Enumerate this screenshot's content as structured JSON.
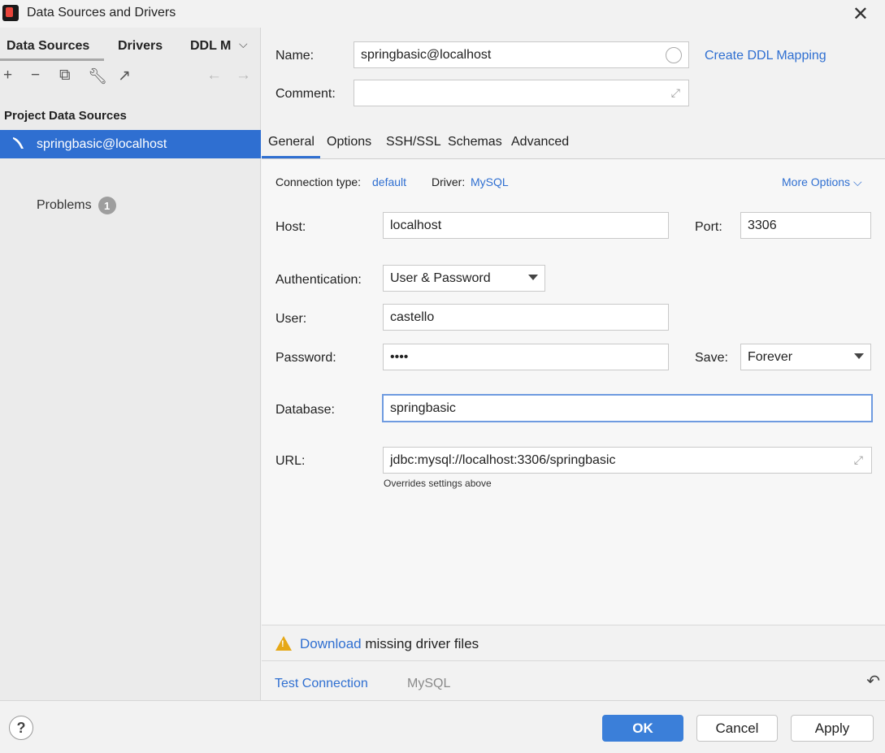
{
  "window": {
    "title": "Data Sources and Drivers"
  },
  "left": {
    "tabs": [
      "Data Sources",
      "Drivers",
      "DDL M"
    ],
    "section_title": "Project Data Sources",
    "selected_item": "springbasic@localhost",
    "problems_label": "Problems",
    "problems_count": "1"
  },
  "form": {
    "name_label": "Name:",
    "name_value": "springbasic@localhost",
    "create_ddl_link": "Create DDL Mapping",
    "comment_label": "Comment:",
    "comment_value": ""
  },
  "tabs": [
    "General",
    "Options",
    "SSH/SSL",
    "Schemas",
    "Advanced"
  ],
  "general": {
    "connection_type_label": "Connection type:",
    "connection_type_value": "default",
    "driver_label": "Driver:",
    "driver_value": "MySQL",
    "more_options": "More Options",
    "host_label": "Host:",
    "host_value": "localhost",
    "port_label": "Port:",
    "port_value": "3306",
    "auth_label": "Authentication:",
    "auth_value": "User & Password",
    "user_label": "User:",
    "user_value": "castello",
    "password_label": "Password:",
    "password_value": "••••",
    "save_label": "Save:",
    "save_value": "Forever",
    "database_label": "Database:",
    "database_value": "springbasic",
    "url_label": "URL:",
    "url_value": "jdbc:mysql://localhost:3306/springbasic",
    "url_hint": "Overrides settings above"
  },
  "warning": {
    "link": "Download",
    "text": " missing driver files"
  },
  "footer": {
    "test_connection": "Test Connection",
    "driver_name": "MySQL"
  },
  "buttons": {
    "help": "?",
    "ok": "OK",
    "cancel": "Cancel",
    "apply": "Apply"
  },
  "colors": {
    "accent": "#2f6fd1",
    "selection": "#2f6fd1",
    "warning": "#e6a817"
  }
}
